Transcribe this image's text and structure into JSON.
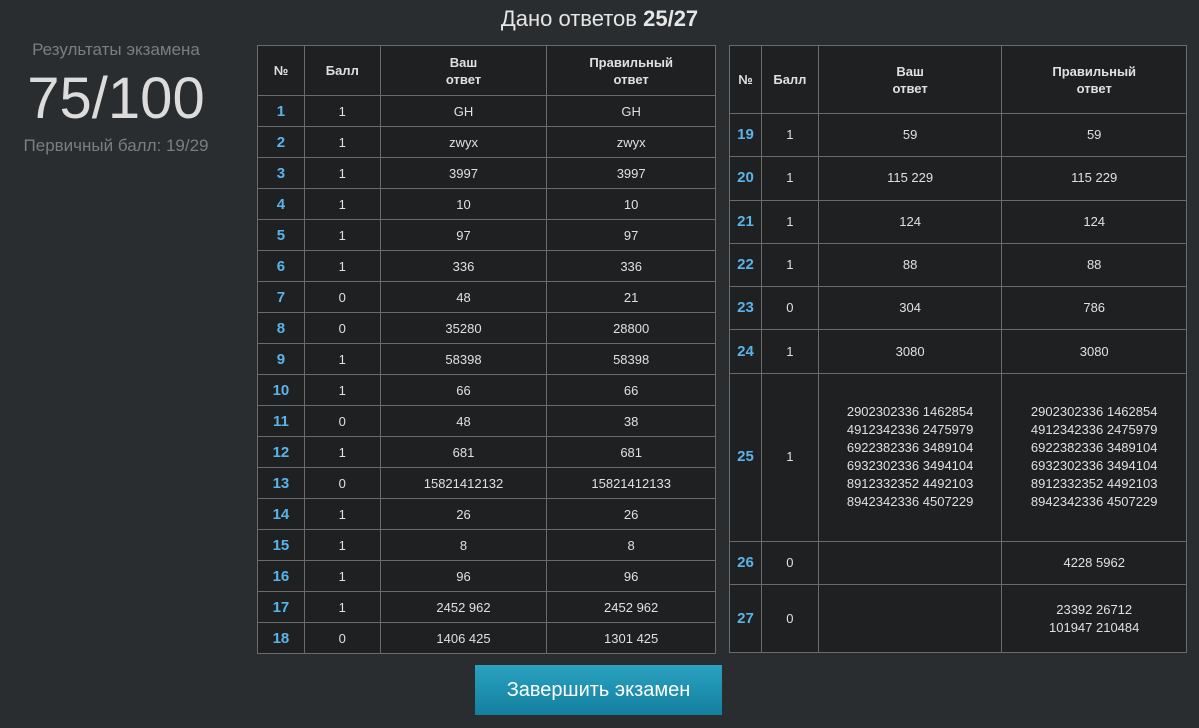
{
  "header": {
    "title_prefix": "Дано ответов",
    "title_value": "25/27"
  },
  "summary": {
    "label": "Результаты экзамена",
    "score": "75/100",
    "primary": "Первичный балл: 19/29"
  },
  "columns": {
    "num": "№",
    "score": "Балл",
    "yours_1": "Ваш",
    "yours_2": "ответ",
    "correct_1": "Правильный",
    "correct_2": "ответ"
  },
  "table_left": [
    [
      "1",
      "1",
      "GH",
      "GH"
    ],
    [
      "2",
      "1",
      "zwyx",
      "zwyx"
    ],
    [
      "3",
      "1",
      "3997",
      "3997"
    ],
    [
      "4",
      "1",
      "10",
      "10"
    ],
    [
      "5",
      "1",
      "97",
      "97"
    ],
    [
      "6",
      "1",
      "336",
      "336"
    ],
    [
      "7",
      "0",
      "48",
      "21"
    ],
    [
      "8",
      "0",
      "35280",
      "28800"
    ],
    [
      "9",
      "1",
      "58398",
      "58398"
    ],
    [
      "10",
      "1",
      "66",
      "66"
    ],
    [
      "11",
      "0",
      "48",
      "38"
    ],
    [
      "12",
      "1",
      "681",
      "681"
    ],
    [
      "13",
      "0",
      "15821412132",
      "15821412133"
    ],
    [
      "14",
      "1",
      "26",
      "26"
    ],
    [
      "15",
      "1",
      "8",
      "8"
    ],
    [
      "16",
      "1",
      "96",
      "96"
    ],
    [
      "17",
      "1",
      "2452 962",
      "2452 962"
    ],
    [
      "18",
      "0",
      "1406 425",
      "1301 425"
    ]
  ],
  "table_right": [
    [
      "19",
      "1",
      "59",
      "59"
    ],
    [
      "20",
      "1",
      "115 229",
      "115 229"
    ],
    [
      "21",
      "1",
      "124",
      "124"
    ],
    [
      "22",
      "1",
      "88",
      "88"
    ],
    [
      "23",
      "0",
      "304",
      "786"
    ],
    [
      "24",
      "1",
      "3080",
      "3080"
    ],
    [
      "25",
      "1",
      "2902302336 1462854\n4912342336 2475979\n6922382336 3489104\n6932302336 3494104\n8912332352 4492103\n8942342336 4507229",
      "2902302336 1462854\n4912342336 2475979\n6922382336 3489104\n6932302336 3494104\n8912332352 4492103\n8942342336 4507229"
    ],
    [
      "26",
      "0",
      "",
      "4228 5962"
    ],
    [
      "27",
      "0",
      "",
      "23392 26712\n101947 210484"
    ]
  ],
  "finish_button": "Завершить экзамен"
}
